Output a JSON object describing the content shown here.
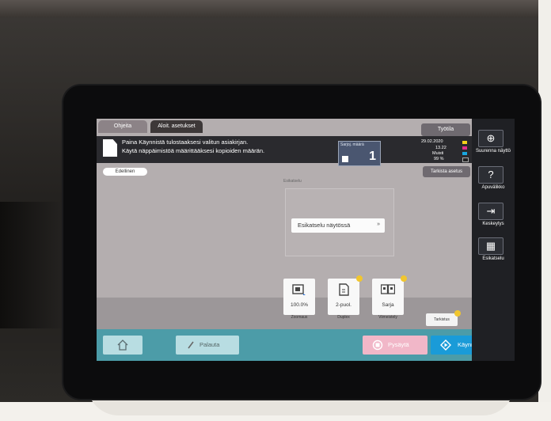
{
  "tabs": {
    "help": "Ohjeita",
    "basic": "Aloit. asetukset"
  },
  "top_right_button": "Työtila",
  "message": {
    "line1": "Paina Käynnistä tulostaaksesi valitun asiakirjan.",
    "line2": "Käytä näppäimistöä määrittääksesi kopioiden määrän."
  },
  "copies": {
    "label": "Sarjoj. määrä",
    "value": "1"
  },
  "status": {
    "date": "29.02.2020",
    "time": "13.22",
    "memory_label": "Muisti",
    "memory_value": "99 %",
    "toner_colors": [
      "#f4d21a",
      "#e0308a",
      "#18a6df",
      "#222222"
    ]
  },
  "previous_button": "Edellinen",
  "preview_settings_button": "Tarkista asetus",
  "preview": {
    "label": "Esikatselu",
    "button": "Esikatselu näytössä",
    "chevron": "»"
  },
  "tiles": [
    {
      "value": "100.0%",
      "caption": "Zoomaus",
      "icon": "zoom-icon"
    },
    {
      "value": "2-puol.",
      "caption": "Duplex",
      "icon": "duplex-icon"
    },
    {
      "value": "Sarja",
      "caption": "Viimeistely",
      "icon": "finishing-icon"
    }
  ],
  "settings_button": "Tarkistus",
  "bottom": {
    "home_icon": "home-icon",
    "reset": "Palauta",
    "stop": "Pysäytä",
    "start": "Käynnistä"
  },
  "side_panel": [
    {
      "icon": "zoom-in-icon",
      "label": "Suurenna näyttö"
    },
    {
      "icon": "help-icon",
      "label": "Apuvälikko"
    },
    {
      "icon": "interrupt-icon",
      "label": "Keskeytys"
    },
    {
      "icon": "preview-icon",
      "label": "Esikatselu"
    }
  ],
  "colors": {
    "start": "#1a9bd8",
    "stop": "#f1b7c8",
    "bottom_bar": "#4c9ca8",
    "screen_bg": "#b4aeaf"
  }
}
